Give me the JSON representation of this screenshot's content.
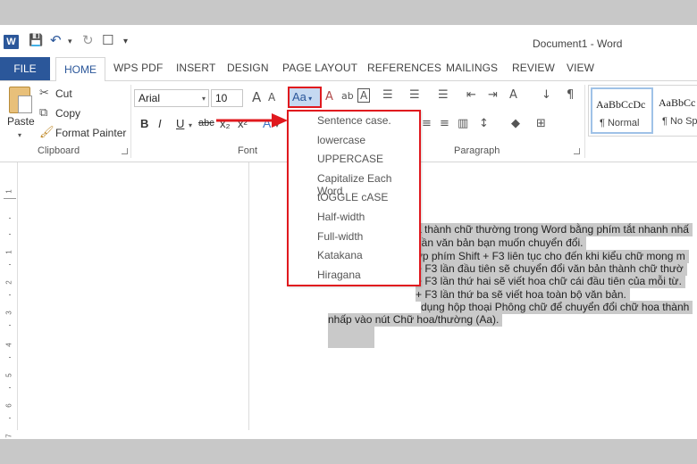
{
  "qat": {
    "logo": "W",
    "save_icon": "💾",
    "undo_icon": "↶",
    "redo_icon": "↻",
    "new_icon": "☐",
    "customize_icon": "▾"
  },
  "window": {
    "title": "Document1 - Word"
  },
  "tabs": {
    "file": "FILE",
    "home": "HOME",
    "items": [
      "WPS PDF",
      "INSERT",
      "DESIGN",
      "PAGE LAYOUT",
      "REFERENCES",
      "MAILINGS",
      "REVIEW",
      "VIEW"
    ]
  },
  "clipboard": {
    "paste": "Paste",
    "cut": "Cut",
    "copy": "Copy",
    "format_painter": "Format Painter",
    "label": "Clipboard"
  },
  "font": {
    "font_name": "Arial",
    "font_size": "10",
    "change_case_label": "Aa",
    "bold": "B",
    "italic": "I",
    "underline": "U",
    "strikethrough": "abc",
    "subscript": "x₂",
    "superscript": "x²",
    "text_effects": "A",
    "label": "Font"
  },
  "paragraph": {
    "label": "Paragraph"
  },
  "styles": {
    "items": [
      {
        "sample": "AaBbCcDc",
        "name": "¶ Normal"
      },
      {
        "sample": "AaBbCc",
        "name": "¶ No Sp"
      }
    ]
  },
  "change_case_menu": {
    "items": [
      "Sentence case.",
      "lowercase",
      "UPPERCASE",
      "Capitalize Each Word",
      "tOGGLE cASE",
      "Half-width",
      "Full-width",
      "Katakana",
      "Hiragana"
    ]
  },
  "ruler": {
    "numbers": [
      "1",
      "1",
      "2",
      "3",
      "4",
      "5",
      "6",
      "7"
    ]
  },
  "document": {
    "lines": [
      "a thành chữ thường trong Word bằng phím tắt nhanh nhấ",
      "hần văn bản bạn muốn chuyển đổi.",
      "ợp phím Shift + F3 liên tục cho đến khi kiểu chữ mong m",
      "+ F3 lần đầu tiên sẽ chuyển đổi văn bản thành chữ thườ",
      "+ F3 lần thứ hai sẽ viết hoa chữ cái đầu tiên của mỗi từ.",
      "+ F3 lần thứ ba sẽ viết hoa toàn bộ văn bản.",
      "dụng hộp thoại Phông chữ để chuyển đổi chữ hoa thành",
      "nhấp vào nút Chữ hoa/thường (Aa)."
    ]
  },
  "colors": {
    "accent": "#2b579a",
    "highlight": "#e0191e",
    "selection": "#c9c9c9"
  }
}
